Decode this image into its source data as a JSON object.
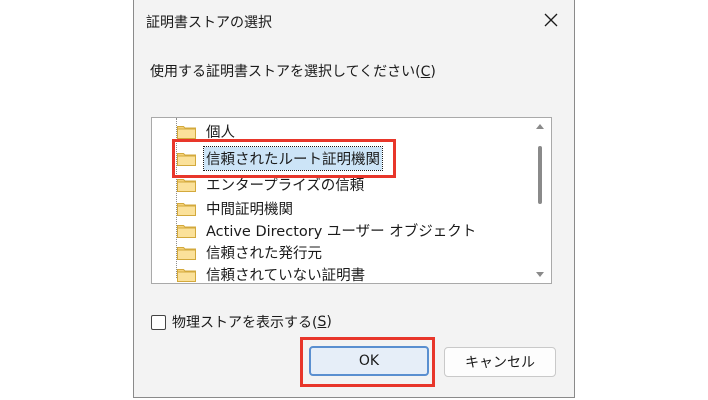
{
  "dialog": {
    "title": "証明書ストアの選択",
    "prompt_before": "使用する証明書ストアを選択してください(",
    "prompt_key": "C",
    "prompt_after": ")"
  },
  "tree": {
    "items": [
      {
        "label": "個人"
      },
      {
        "label": "信頼されたルート証明機関",
        "selected": true
      },
      {
        "label": "エンタープライズの信頼"
      },
      {
        "label": "中間証明機関"
      },
      {
        "label": "Active Directory ユーザー オブジェクト"
      },
      {
        "label": "信頼された発行元"
      },
      {
        "label": "信頼されていない証明書"
      }
    ]
  },
  "checkbox": {
    "label_before": "物理ストアを表示する(",
    "label_key": "S",
    "label_after": ")",
    "checked": false
  },
  "buttons": {
    "ok": "OK",
    "cancel": "キャンセル"
  },
  "colors": {
    "highlight_box": "#e8362a",
    "selection": "#cce4f7",
    "primary_border": "#5a8fd0"
  }
}
